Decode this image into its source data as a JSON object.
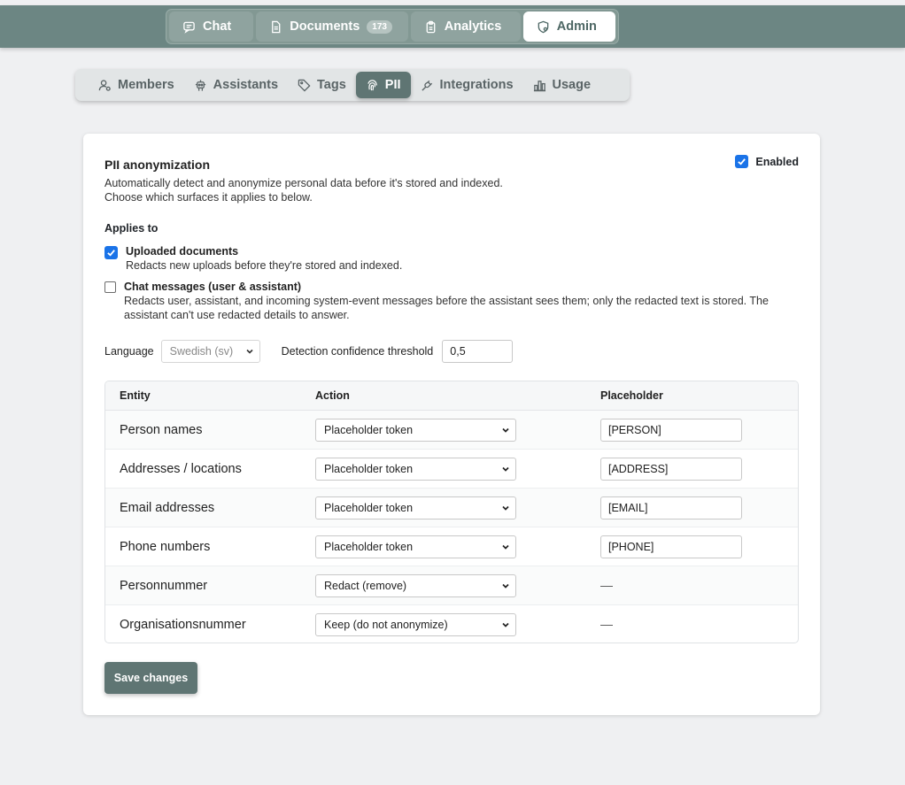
{
  "topnav": [
    {
      "label": "Chat",
      "icon": "chat-icon",
      "active": false
    },
    {
      "label": "Documents",
      "icon": "document-icon",
      "badge": "173",
      "active": false
    },
    {
      "label": "Analytics",
      "icon": "clipboard-icon",
      "active": false
    },
    {
      "label": "Admin",
      "icon": "shield-gear-icon",
      "active": true
    }
  ],
  "subnav": [
    {
      "label": "Members",
      "icon": "members-icon",
      "active": false
    },
    {
      "label": "Assistants",
      "icon": "robot-icon",
      "active": false
    },
    {
      "label": "Tags",
      "icon": "tag-icon",
      "active": false
    },
    {
      "label": "PII",
      "icon": "fingerprint-icon",
      "active": true
    },
    {
      "label": "Integrations",
      "icon": "plug-icon",
      "active": false
    },
    {
      "label": "Usage",
      "icon": "bar-chart-icon",
      "active": false
    }
  ],
  "pii": {
    "title": "PII anonymization",
    "description_1": "Automatically detect and anonymize personal data before it's stored and indexed.",
    "description_2": "Choose which surfaces it applies to below.",
    "enabled_label": "Enabled",
    "enabled": true,
    "applies_to_label": "Applies to",
    "uploaded_label": "Uploaded documents",
    "uploaded_desc": "Redacts new uploads before they're stored and indexed.",
    "uploaded_checked": true,
    "chat_label": "Chat messages (user & assistant)",
    "chat_desc": "Redacts user, assistant, and incoming system-event messages before the assistant sees them; only the redacted text is stored. The assistant can't use redacted details to answer.",
    "chat_checked": false,
    "language_label": "Language",
    "language_value": "Swedish (sv)",
    "threshold_label": "Detection confidence threshold",
    "threshold_value": "0,5",
    "save_label": "Save changes"
  },
  "table": {
    "headers": {
      "entity": "Entity",
      "action": "Action",
      "placeholder": "Placeholder"
    },
    "rows": [
      {
        "entity": "Person names",
        "action": "Placeholder token",
        "placeholder": "[PERSON]"
      },
      {
        "entity": "Addresses / locations",
        "action": "Placeholder token",
        "placeholder": "[ADDRESS]"
      },
      {
        "entity": "Email addresses",
        "action": "Placeholder token",
        "placeholder": "[EMAIL]"
      },
      {
        "entity": "Phone numbers",
        "action": "Placeholder token",
        "placeholder": "[PHONE]"
      },
      {
        "entity": "Personnummer",
        "action": "Redact (remove)",
        "placeholder": "—"
      },
      {
        "entity": "Organisationsnummer",
        "action": "Keep (do not anonymize)",
        "placeholder": "—"
      }
    ]
  },
  "colors": {
    "accent": "#5f7573",
    "topbar": "#6c8683",
    "checkbox": "#1a73e8"
  }
}
